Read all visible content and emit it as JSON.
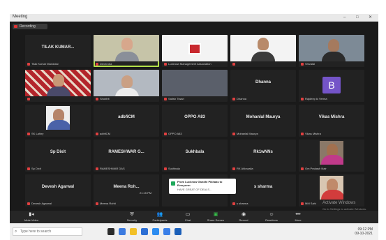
{
  "window": {
    "title": "Meeting",
    "minimize": "–",
    "maximize": "□",
    "close": "✕"
  },
  "recording": {
    "label": "Recording"
  },
  "tiles": [
    {
      "name": "Tilak Kumar Mandolai",
      "big": "TILAK KUMAR...",
      "variant": ""
    },
    {
      "name": "Devendra",
      "big": "",
      "variant": "v1",
      "active": true
    },
    {
      "name": "Lucknow Management Association",
      "big": "",
      "variant": "v2",
      "logo": true
    },
    {
      "name": "",
      "big": "",
      "variant": "v2"
    },
    {
      "name": "Shivalal",
      "big": "",
      "variant": "v3"
    },
    {
      "name": "",
      "big": "",
      "variant": "v5"
    },
    {
      "name": "Shobhit",
      "big": "",
      "variant": "v4"
    },
    {
      "name": "Satish Tiwari",
      "big": "",
      "variant": "v6"
    },
    {
      "name": "Dhanna",
      "big": "Dhanna",
      "variant": ""
    },
    {
      "name": "Rajdeep ki Verma",
      "big": "",
      "variant": "",
      "avatarB": "B"
    },
    {
      "name": "SK Lahiry",
      "big": "",
      "variant": "v2"
    },
    {
      "name": "adbfiCM",
      "big": "adbfiCM",
      "variant": ""
    },
    {
      "name": "OPPO A83",
      "big": "OPPO A83",
      "variant": ""
    },
    {
      "name": "Mohanlal Maurya",
      "big": "Mohanlal Maurya",
      "variant": ""
    },
    {
      "name": "Vikas Mishra",
      "big": "Vikas Mishra",
      "variant": ""
    },
    {
      "name": "Sp Dixit",
      "big": "Sp Dixit",
      "variant": ""
    },
    {
      "name": "RAMESHWAR DAS",
      "big": "RAMESHWAR G...",
      "variant": ""
    },
    {
      "name": "Sukhbala",
      "big": "Sukhbala",
      "variant": ""
    },
    {
      "name": "RK Ahluwalia",
      "big": "Rk1wNNs",
      "variant": ""
    },
    {
      "name": "Om Prakash Nair",
      "big": "",
      "variant": "v7"
    },
    {
      "name": "Devesh Agarwal",
      "big": "Devesh Agarwal",
      "variant": ""
    },
    {
      "name": "Meena Rohit",
      "big": "Meena Roh...",
      "variant": ""
    },
    {
      "name": "",
      "big": "",
      "variant": ""
    },
    {
      "name": "s sharma",
      "big": "s sharma",
      "variant": ""
    },
    {
      "name": "MM Sahi",
      "big": "",
      "variant": "v11"
    }
  ],
  "chat": {
    "from": "From Lucknow Gandhi Pikhaas to Everyone:",
    "message": "HAVE GREAT OF DEALS...",
    "time": "21:15 PM"
  },
  "watermark": {
    "line1": "Activate Windows",
    "line2": "Go to Settings to activate Windows."
  },
  "toolbar": [
    {
      "icon": "mic",
      "label": "Mute Video"
    },
    {
      "icon": "shield",
      "label": "Security"
    },
    {
      "icon": "people",
      "label": "Participants"
    },
    {
      "icon": "chat",
      "label": "Chat"
    },
    {
      "icon": "share",
      "label": "Share Screen"
    },
    {
      "icon": "record",
      "label": "Record"
    },
    {
      "icon": "reactions",
      "label": "Reactions"
    },
    {
      "icon": "more",
      "label": "More"
    }
  ],
  "taskbar": {
    "search_placeholder": "Type here to search",
    "time": "09:12 PM",
    "date": "09-10-2021"
  },
  "colors": {
    "active_tile": "#b4e04a",
    "share_green": "#37c24a",
    "avatar_b": "#7454c8"
  }
}
